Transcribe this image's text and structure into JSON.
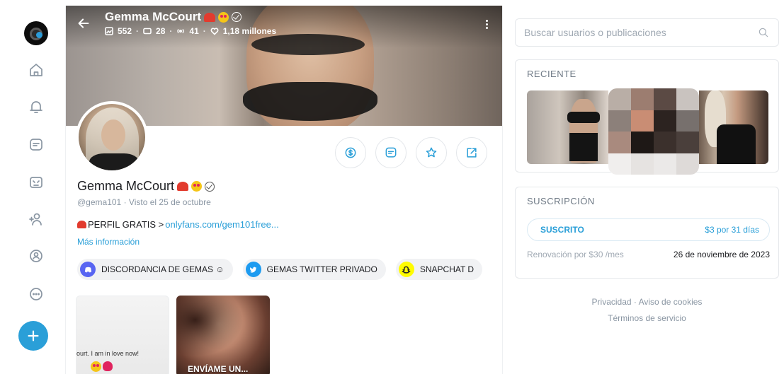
{
  "nav": {
    "items": [
      {
        "icon": "home-icon"
      },
      {
        "icon": "bell-icon"
      },
      {
        "icon": "messages-icon"
      },
      {
        "icon": "collections-icon"
      },
      {
        "icon": "subscriptions-icon"
      },
      {
        "icon": "profile-icon"
      },
      {
        "icon": "more-icon"
      }
    ],
    "add_icon": "plus-icon"
  },
  "header": {
    "name": "Gemma McCourt",
    "stats": {
      "posts": "552",
      "videos": "28",
      "streams": "41",
      "likes": "1,18 millones"
    }
  },
  "profile": {
    "name": "Gemma McCourt",
    "handle": "@gema101",
    "seen": "Visto  el 25 de octubre",
    "bio_prefix": "PERFIL GRATIS >",
    "bio_link": "onlyfans.com/gem101free...",
    "more_info": "Más información",
    "chips": [
      {
        "label": "DISCORDANCIA DE GEMAS ☺",
        "icon": "discord-icon"
      },
      {
        "label": "GEMAS TWITTER PRIVADO",
        "icon": "twitter-icon"
      },
      {
        "label": "SNAPCHAT D",
        "icon": "snapchat-icon"
      }
    ],
    "thumbs": [
      {
        "caption": "ourt. I am in love now!"
      },
      {
        "caption": "ENVÍAME UN..."
      }
    ]
  },
  "colors": {
    "accent": "#2a9fd8",
    "muted": "#8a96a3"
  },
  "sidebar": {
    "search_placeholder": "Buscar usuarios o publicaciones",
    "recent_title": "RECIENTE",
    "subscription": {
      "title": "SUSCRIPCIÓN",
      "status": "SUSCRITO",
      "price": "$3 por 31 días",
      "renewal_label": "Renovación por $30 /mes",
      "renewal_date": "26 de noviembre de 2023"
    },
    "footer": {
      "privacy": "Privacidad",
      "cookies": "Aviso de cookies",
      "terms": "Términos de servicio"
    }
  }
}
